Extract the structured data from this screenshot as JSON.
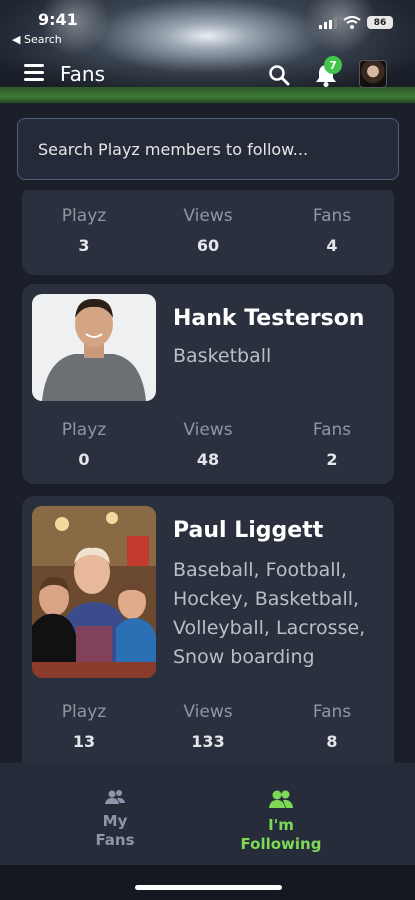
{
  "status_bar": {
    "time": "9:41",
    "back_label": "◀ Search",
    "battery": "86"
  },
  "header": {
    "title": "Fans",
    "notification_count": "7"
  },
  "search": {
    "placeholder": "Search Playz members to follow..."
  },
  "cards": [
    {
      "stats": [
        {
          "label": "Playz",
          "value": "3"
        },
        {
          "label": "Views",
          "value": "60"
        },
        {
          "label": "Fans",
          "value": "4"
        }
      ]
    },
    {
      "name": "Hank Testerson",
      "sports": "Basketball",
      "stats": [
        {
          "label": "Playz",
          "value": "0"
        },
        {
          "label": "Views",
          "value": "48"
        },
        {
          "label": "Fans",
          "value": "2"
        }
      ]
    },
    {
      "name": "Paul Liggett",
      "sports": "Baseball, Football, Hockey, Basketball, Volleyball, Lacrosse, Snow boarding",
      "stats": [
        {
          "label": "Playz",
          "value": "13"
        },
        {
          "label": "Views",
          "value": "133"
        },
        {
          "label": "Fans",
          "value": "8"
        }
      ]
    }
  ],
  "tabs": [
    {
      "label": "My Fans",
      "active": false
    },
    {
      "label": "I'm Following",
      "active": true
    }
  ],
  "colors": {
    "accent": "#7ed957",
    "inactive_tab": "#8c97ab",
    "card": "#2b303e",
    "background": "#1b1f29"
  }
}
